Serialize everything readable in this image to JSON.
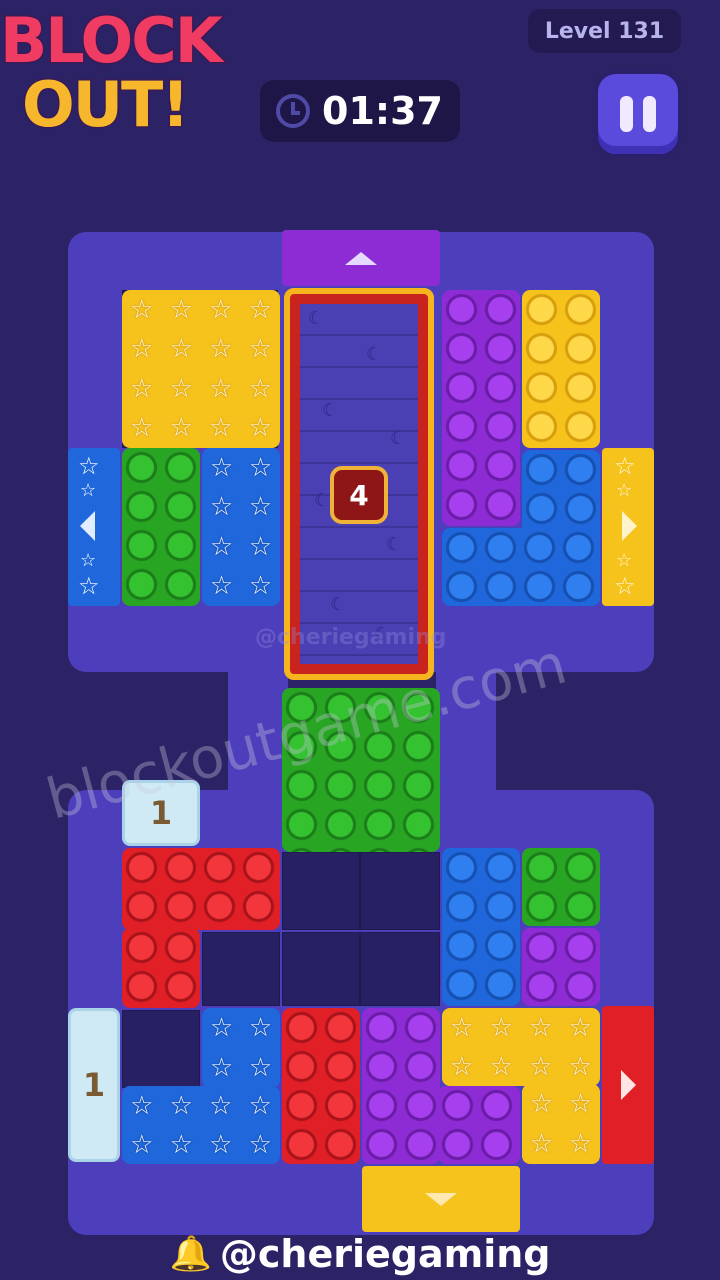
{
  "game": {
    "logo_line1": "BLOCK",
    "logo_line2": "OUT!",
    "level": "Level 131",
    "timer": "01:37"
  },
  "board": {
    "tile_counter": "4",
    "ice_block_top": "1",
    "ice_block_bottom": "1"
  },
  "colors": {
    "yellow": "#f6c21c",
    "green": "#27a523",
    "blue": "#1f67db",
    "purple": "#8d2cd4",
    "red": "#e01f27",
    "background": "#2c2266"
  },
  "icons": {
    "timer": "clock-icon",
    "pause": "pause-icon",
    "bell": "bell-icon"
  },
  "watermarks": {
    "site": "blockoutgame.com",
    "faint": "@cheriegaming"
  },
  "footer": {
    "channel": "@cheriegaming"
  }
}
